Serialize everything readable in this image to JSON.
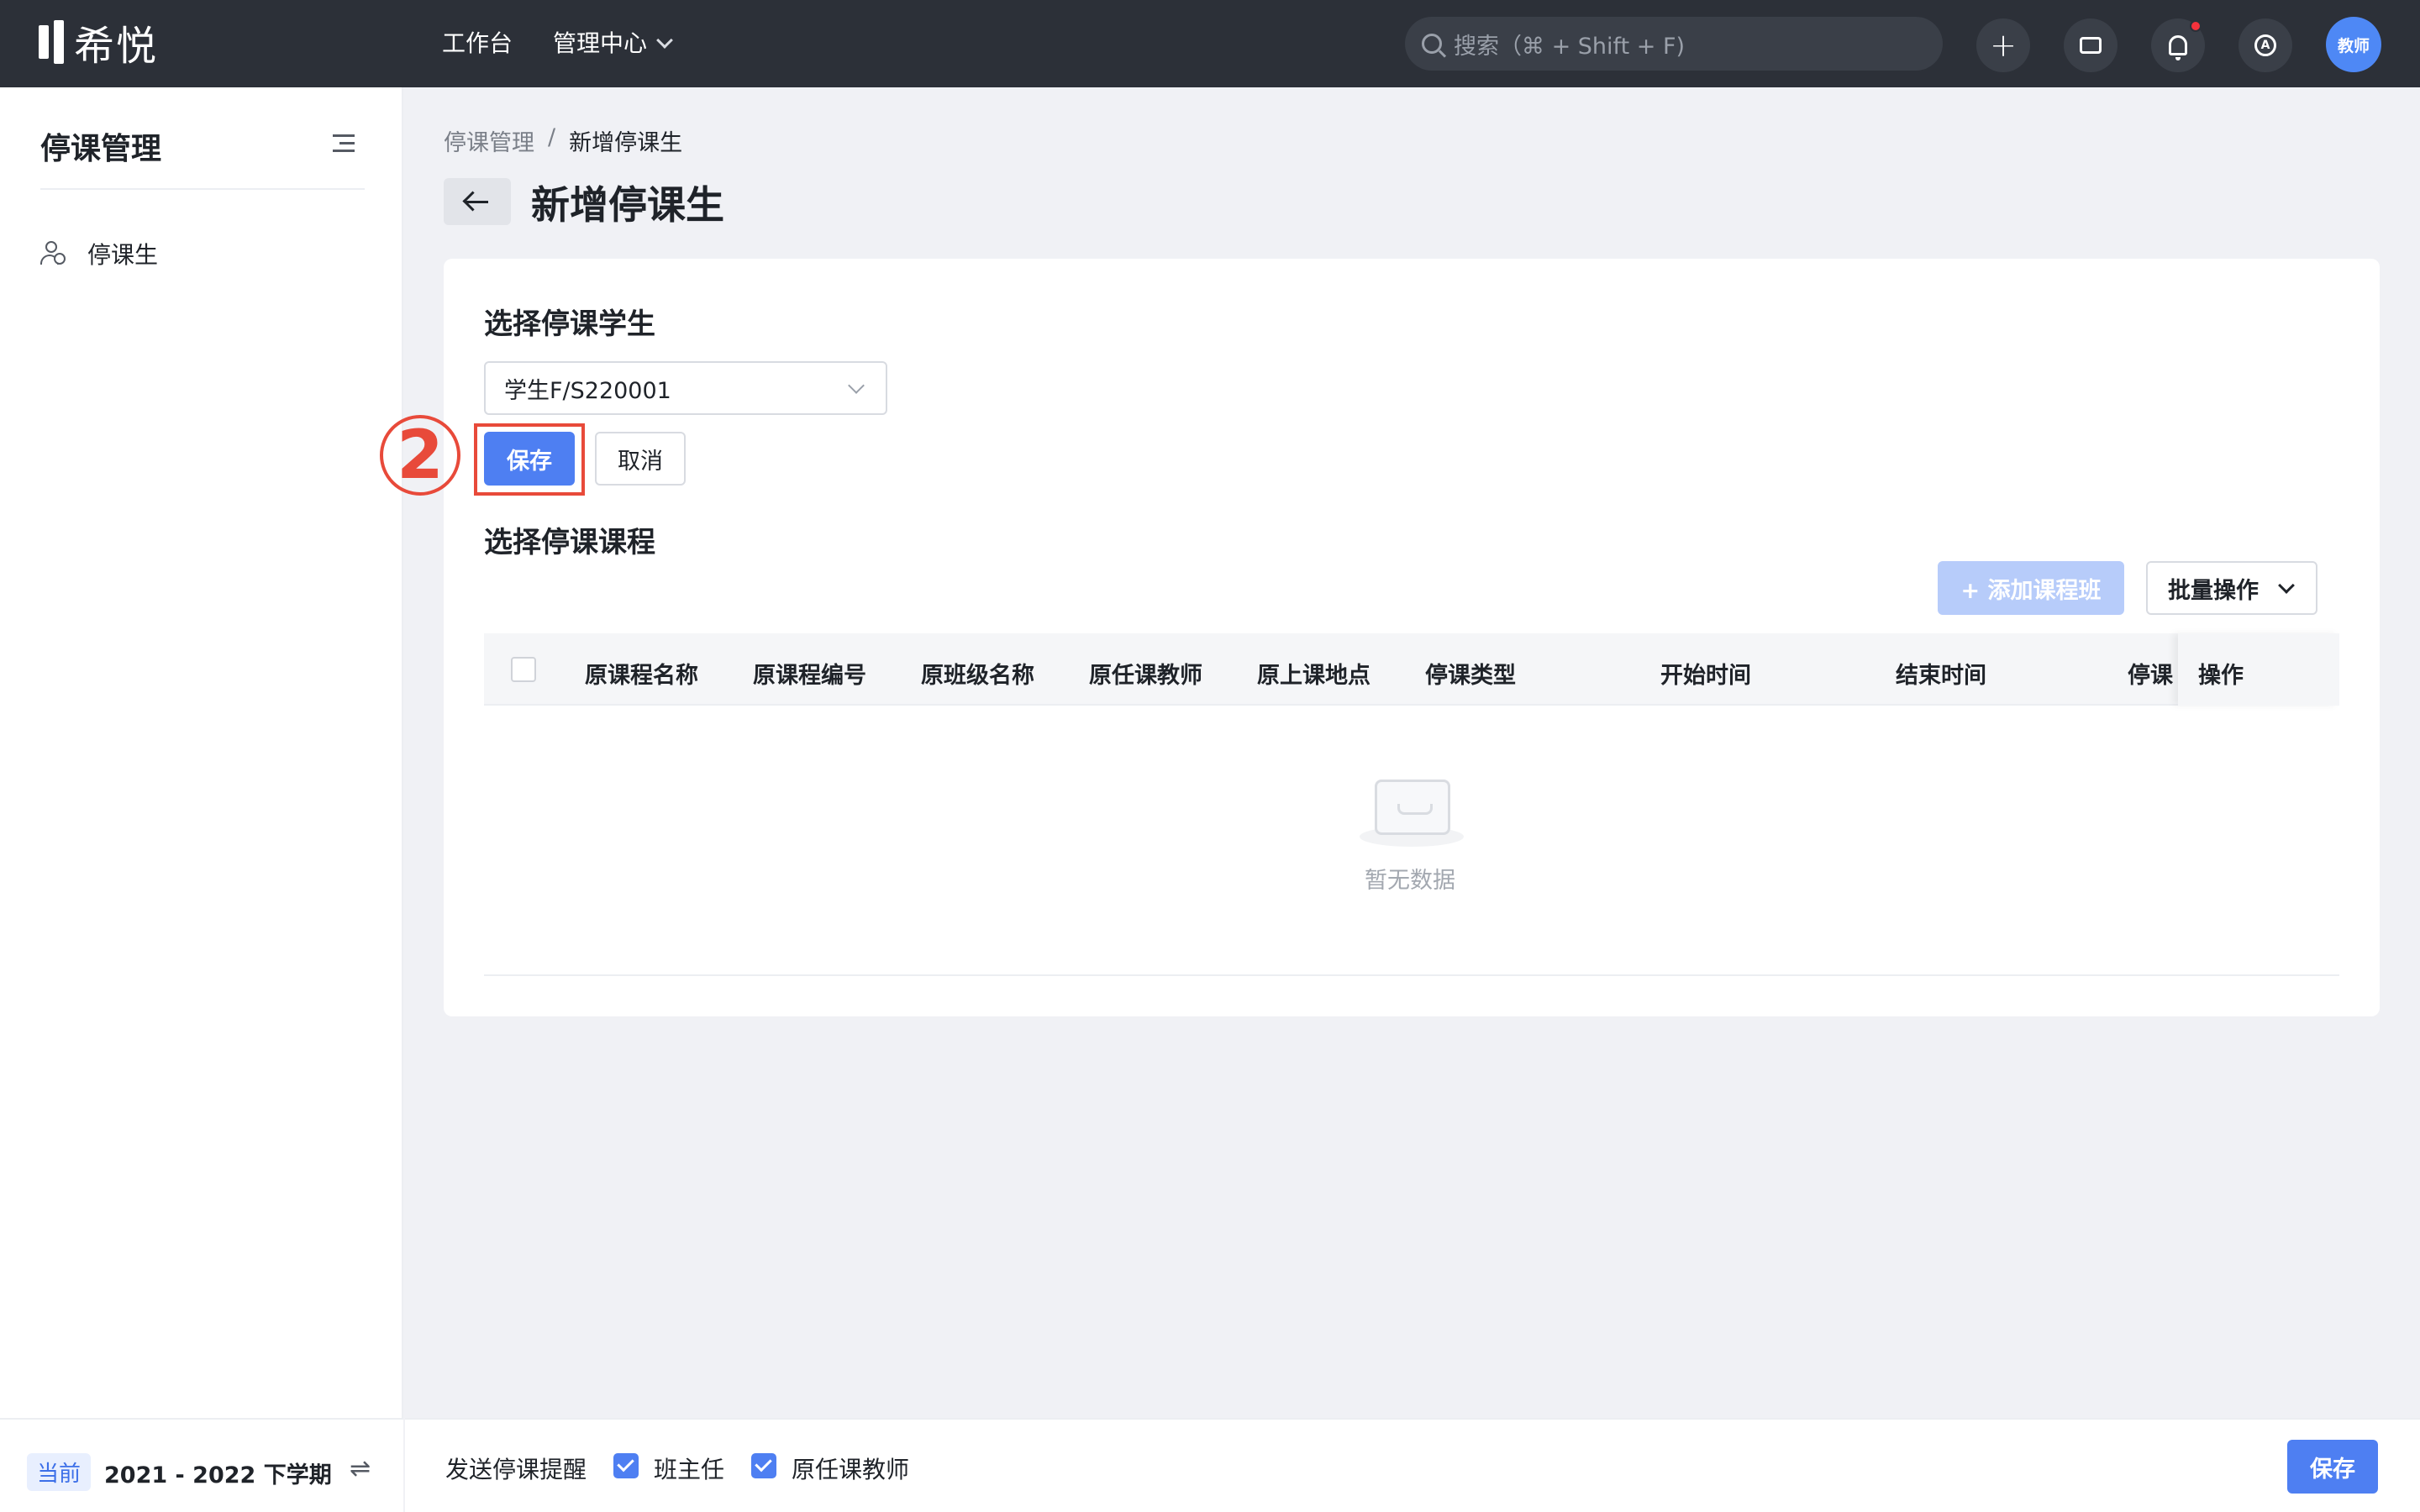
{
  "app": {
    "logo_text": "希悦"
  },
  "topnav": {
    "workbench": "工作台",
    "admin_center": "管理中心",
    "search_placeholder": "搜索（⌘ + Shift + F)",
    "avatar_text": "教师"
  },
  "sidebar": {
    "title": "停课管理",
    "items": [
      {
        "label": "停课生",
        "icon": "user-clock-icon"
      }
    ],
    "footer": {
      "badge": "当前",
      "term": "2021 - 2022 下学期"
    }
  },
  "breadcrumb": {
    "parent": "停课管理",
    "separator": "/",
    "current": "新增停课生"
  },
  "page": {
    "title": "新增停课生"
  },
  "form": {
    "student_section_title": "选择停课学生",
    "student_value": "学生F/S220001",
    "save_label": "保存",
    "cancel_label": "取消",
    "annotation_step": "2",
    "course_section_title": "选择停课课程",
    "add_class_label": "+ 添加课程班",
    "batch_label": "批量操作"
  },
  "table": {
    "columns": [
      "原课程名称",
      "原课程编号",
      "原班级名称",
      "原任课教师",
      "原上课地点",
      "停课类型",
      "开始时间",
      "结束时间",
      "停课",
      "操作"
    ],
    "empty_text": "暂无数据"
  },
  "footer": {
    "notify_label": "发送停课提醒",
    "options": [
      {
        "label": "班主任",
        "checked": true
      },
      {
        "label": "原任课教师",
        "checked": true
      }
    ],
    "save_label": "保存"
  },
  "colors": {
    "primary": "#4e7ff2",
    "topbar": "#2c3038",
    "annotation_red": "#e84a3a"
  }
}
